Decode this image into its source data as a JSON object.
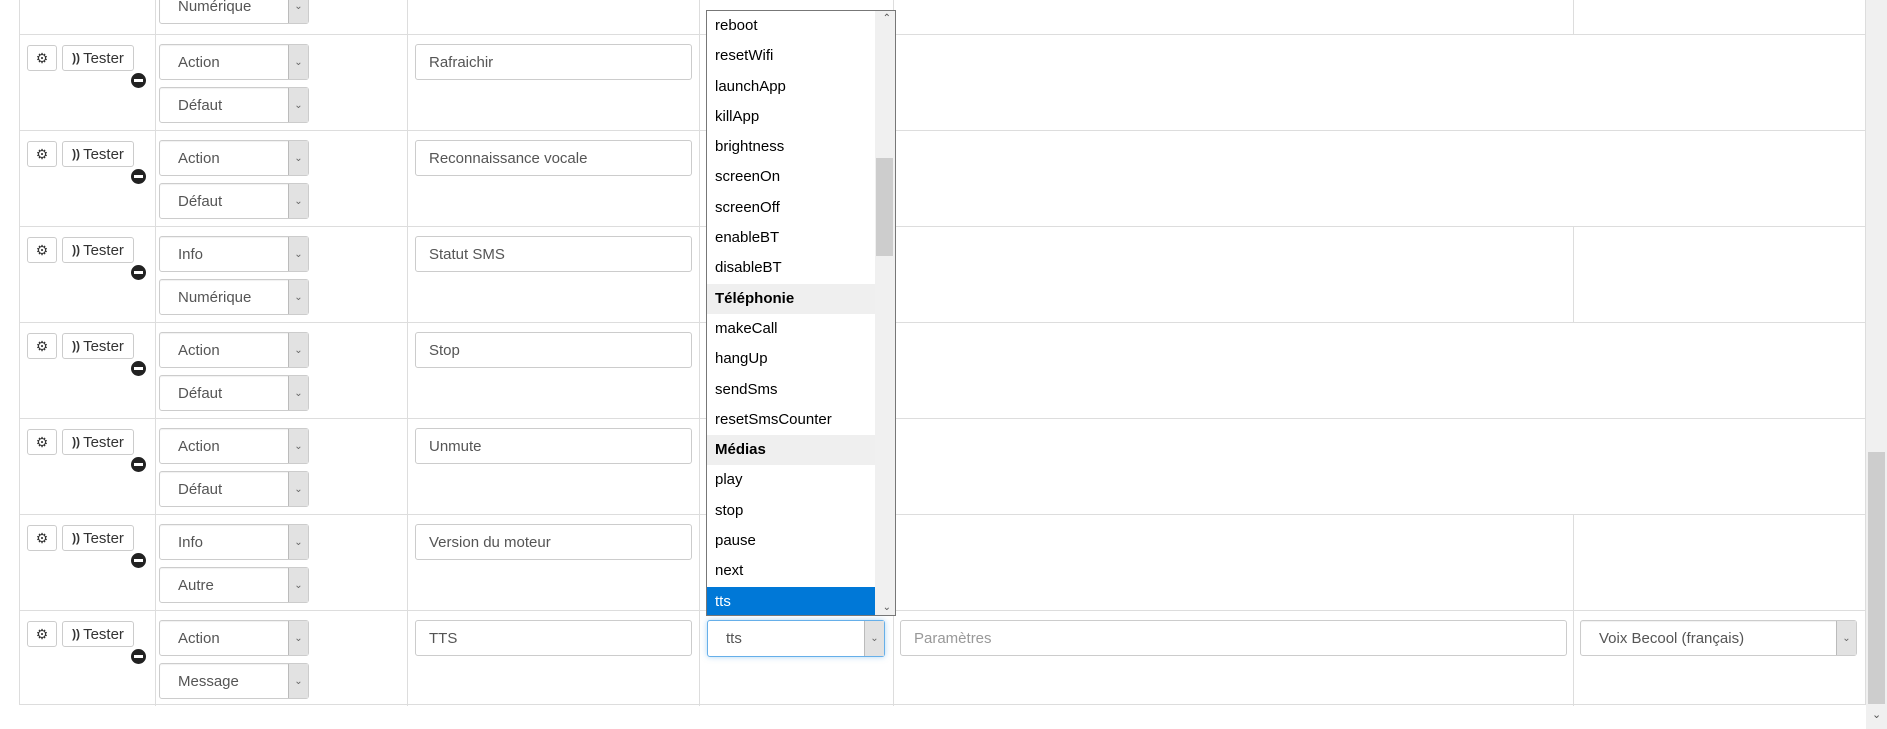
{
  "top_row": {
    "subtype": "Numérique"
  },
  "commands": [
    {
      "type": "Action",
      "subtype": "Défaut",
      "name": "Rafraichir"
    },
    {
      "type": "Action",
      "subtype": "Défaut",
      "name": "Reconnaissance vocale"
    },
    {
      "type": "Info",
      "subtype": "Numérique",
      "name": "Statut SMS"
    },
    {
      "type": "Action",
      "subtype": "Défaut",
      "name": "Stop"
    },
    {
      "type": "Action",
      "subtype": "Défaut",
      "name": "Unmute"
    },
    {
      "type": "Info",
      "subtype": "Autre",
      "name": "Version du moteur"
    },
    {
      "type": "Action",
      "subtype": "Message",
      "name": "TTS",
      "logical_id": "tts",
      "params_placeholder": "Paramètres",
      "voice": "Voix Becool (français)"
    }
  ],
  "buttons": {
    "tester": "Tester",
    "config_icon": "gears-icon",
    "tester_icon": "rss-icon",
    "remove_icon": "minus-circle-icon"
  },
  "dropdown": {
    "items": [
      {
        "label": "reboot"
      },
      {
        "label": "resetWifi"
      },
      {
        "label": "launchApp"
      },
      {
        "label": "killApp"
      },
      {
        "label": "brightness"
      },
      {
        "label": "screenOn"
      },
      {
        "label": "screenOff"
      },
      {
        "label": "enableBT"
      },
      {
        "label": "disableBT"
      },
      {
        "label": "Téléphonie",
        "group": true
      },
      {
        "label": "makeCall"
      },
      {
        "label": "hangUp"
      },
      {
        "label": "sendSms"
      },
      {
        "label": "resetSmsCounter"
      },
      {
        "label": "Médias",
        "group": true
      },
      {
        "label": "play"
      },
      {
        "label": "stop"
      },
      {
        "label": "pause"
      },
      {
        "label": "next"
      },
      {
        "label": "tts",
        "selected": true
      }
    ]
  },
  "colors": {
    "selected": "#0078d7",
    "border": "#dddddd"
  }
}
